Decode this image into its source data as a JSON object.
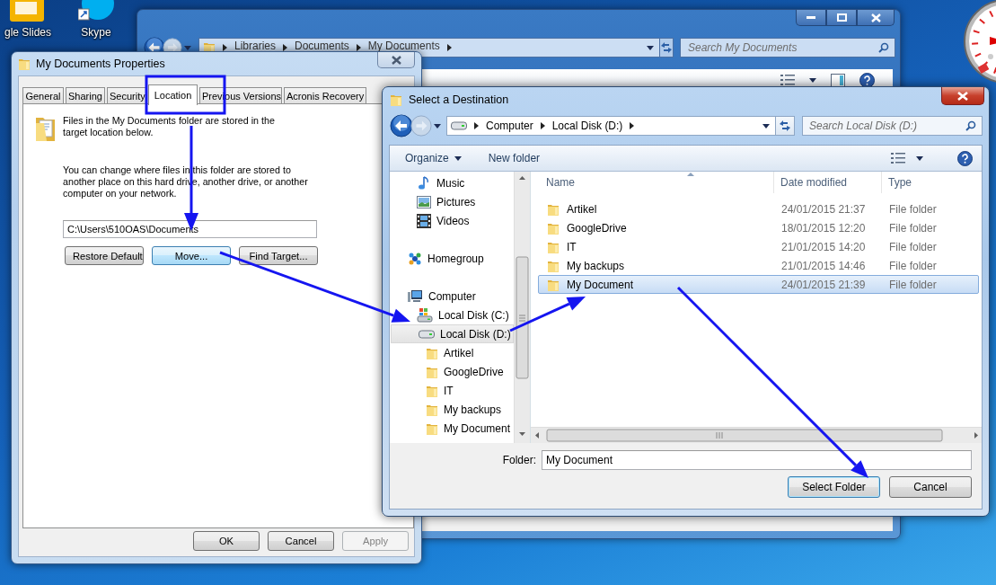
{
  "desktop_icons": [
    {
      "label": "gle Slides",
      "kind": "slides"
    },
    {
      "label": "Skype",
      "kind": "skype"
    }
  ],
  "background_window": {
    "breadcrumb": [
      "Libraries",
      "Documents",
      "My Documents"
    ],
    "search": {
      "placeholder": "Search My Documents"
    }
  },
  "properties_dialog": {
    "title": "My Documents Properties",
    "tabs": [
      {
        "label": "General",
        "selected": false
      },
      {
        "label": "Sharing",
        "selected": false
      },
      {
        "label": "Security",
        "selected": false
      },
      {
        "label": "Location",
        "selected": true
      },
      {
        "label": "Previous Versions",
        "selected": false
      },
      {
        "label": "Acronis Recovery",
        "selected": false
      }
    ],
    "description": "Files in the My Documents folder are stored in the target location below.",
    "help_text": "You can change where files in this folder are stored to another place on this hard drive, another drive, or another computer on your network.",
    "path": {
      "value": "C:\\Users\\510OAS\\Documents"
    },
    "buttons": [
      {
        "label": "Restore Default",
        "focused": false
      },
      {
        "label": "Move...",
        "focused": true
      },
      {
        "label": "Find Target...",
        "focused": false
      }
    ],
    "footer_buttons": [
      {
        "label": "OK",
        "disabled": false
      },
      {
        "label": "Cancel",
        "disabled": false
      },
      {
        "label": "Apply",
        "disabled": true
      }
    ]
  },
  "destination_dialog": {
    "title": "Select a Destination",
    "breadcrumb": [
      "Computer",
      "Local Disk (D:)"
    ],
    "search": {
      "placeholder": "Search Local Disk (D:)"
    },
    "toolbar": [
      {
        "label": "Organize",
        "kind": "menu"
      },
      {
        "label": "New folder",
        "kind": "button"
      }
    ],
    "tree": {
      "library_items": [
        {
          "label": "Music",
          "kind": "music",
          "selected": false
        },
        {
          "label": "Pictures",
          "kind": "pictures",
          "selected": false
        },
        {
          "label": "Videos",
          "kind": "videos",
          "selected": false
        }
      ],
      "nodes": [
        {
          "label": "Homegroup",
          "kind": "homegroup",
          "selected": false
        },
        {
          "label": "Computer",
          "kind": "computer",
          "selected": false,
          "children": [
            {
              "label": "Local Disk (C:)",
              "kind": "system-drive",
              "selected": false
            },
            {
              "label": "Local Disk (D:)",
              "kind": "drive",
              "selected": true,
              "children": [
                {
                  "label": "Artikel",
                  "kind": "folder",
                  "selected": false
                },
                {
                  "label": "GoogleDrive",
                  "kind": "folder",
                  "selected": false
                },
                {
                  "label": "IT",
                  "kind": "folder",
                  "selected": false
                },
                {
                  "label": "My backups",
                  "kind": "folder",
                  "selected": false
                },
                {
                  "label": "My Document",
                  "kind": "folder",
                  "selected": false
                }
              ]
            }
          ]
        }
      ]
    },
    "table": {
      "columns": [
        "Name",
        "Date modified",
        "Type"
      ],
      "rows": [
        {
          "name": "Artikel",
          "date": "24/01/2015 21:37",
          "type": "File folder",
          "selected": false
        },
        {
          "name": "GoogleDrive",
          "date": "18/01/2015 12:20",
          "type": "File folder",
          "selected": false
        },
        {
          "name": "IT",
          "date": "21/01/2015 14:20",
          "type": "File folder",
          "selected": false
        },
        {
          "name": "My backups",
          "date": "21/01/2015 14:46",
          "type": "File folder",
          "selected": false
        },
        {
          "name": "My Document",
          "date": "24/01/2015 21:39",
          "type": "File folder",
          "selected": true
        }
      ]
    },
    "folder_field": {
      "label": "Folder:",
      "value": "My Document"
    },
    "buttons": [
      {
        "label": "Select Folder",
        "default": true
      },
      {
        "label": "Cancel",
        "default": false
      }
    ]
  }
}
